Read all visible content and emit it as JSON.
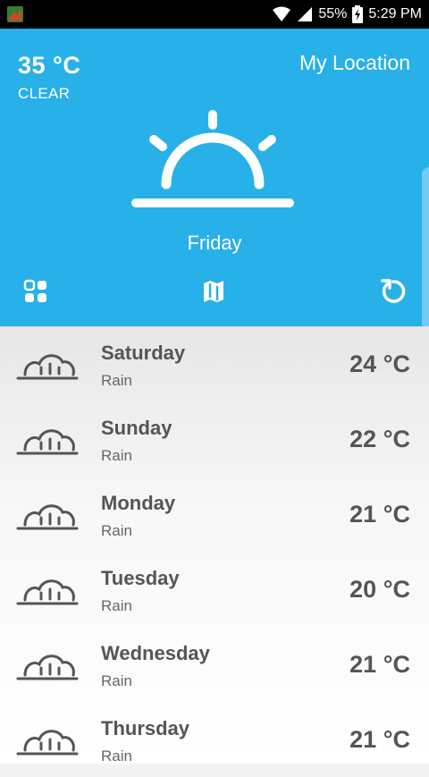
{
  "status_bar": {
    "battery": "55%",
    "time": "5:29 PM"
  },
  "current": {
    "temperature": "35 °C",
    "condition": "CLEAR",
    "location": "My Location",
    "day": "Friday",
    "icon": "sunrise-icon"
  },
  "toolbar": {
    "left_icon": "grid-icon",
    "center_icon": "map-icon",
    "right_icon": "refresh-icon"
  },
  "forecast": [
    {
      "day": "Saturday",
      "condition": "Rain",
      "temperature": "24 °C",
      "icon": "rain-icon"
    },
    {
      "day": "Sunday",
      "condition": "Rain",
      "temperature": "22 °C",
      "icon": "rain-icon"
    },
    {
      "day": "Monday",
      "condition": "Rain",
      "temperature": "21 °C",
      "icon": "rain-icon"
    },
    {
      "day": "Tuesday",
      "condition": "Rain",
      "temperature": "20 °C",
      "icon": "rain-icon"
    },
    {
      "day": "Wednesday",
      "condition": "Rain",
      "temperature": "21 °C",
      "icon": "rain-icon"
    },
    {
      "day": "Thursday",
      "condition": "Rain",
      "temperature": "21 °C",
      "icon": "rain-icon"
    }
  ],
  "colors": {
    "header": "#28b0e8",
    "text_dark": "#555555",
    "text_muted": "#666666"
  }
}
